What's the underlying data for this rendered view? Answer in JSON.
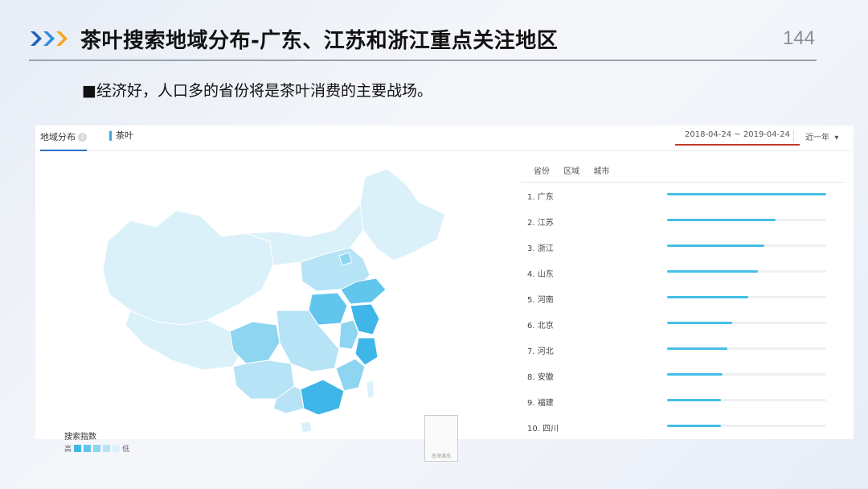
{
  "slide": {
    "title": "茶叶搜索地域分布-广东、江苏和浙江重点关注地区",
    "page_number": "144",
    "bullet": "■经济好，人口多的省份将是茶叶消费的主要战场。",
    "accent_colors": [
      "#1f5fbf",
      "#2f8de0",
      "#f5a623"
    ]
  },
  "panel": {
    "tab_label": "地域分布",
    "info_icon": "info-icon",
    "keyword": "茶叶",
    "date_range": "2018-04-24 ~ 2019-04-24",
    "range_select": "近一年",
    "range_caret": "▾",
    "legend": {
      "title": "搜索指数",
      "high": "高",
      "low": "低",
      "colors": [
        "#3fb6e8",
        "#62c6ec",
        "#8dd5f0",
        "#b6e3f5",
        "#dbf1fa"
      ]
    },
    "inset_label": "南海诸岛",
    "rank_tabs": [
      "省份",
      "区域",
      "城市"
    ],
    "bar_color": "#44bfe6",
    "ranking": [
      {
        "label": "1.  广东",
        "value": 1.0
      },
      {
        "label": "2.  江苏",
        "value": 0.68
      },
      {
        "label": "3.  浙江",
        "value": 0.61
      },
      {
        "label": "4.  山东",
        "value": 0.57
      },
      {
        "label": "5.  河南",
        "value": 0.51
      },
      {
        "label": "6.  北京",
        "value": 0.41
      },
      {
        "label": "7.  河北",
        "value": 0.38
      },
      {
        "label": "8.  安徽",
        "value": 0.35
      },
      {
        "label": "9.  福建",
        "value": 0.34
      },
      {
        "label": "10. 四川",
        "value": 0.34
      }
    ]
  }
}
